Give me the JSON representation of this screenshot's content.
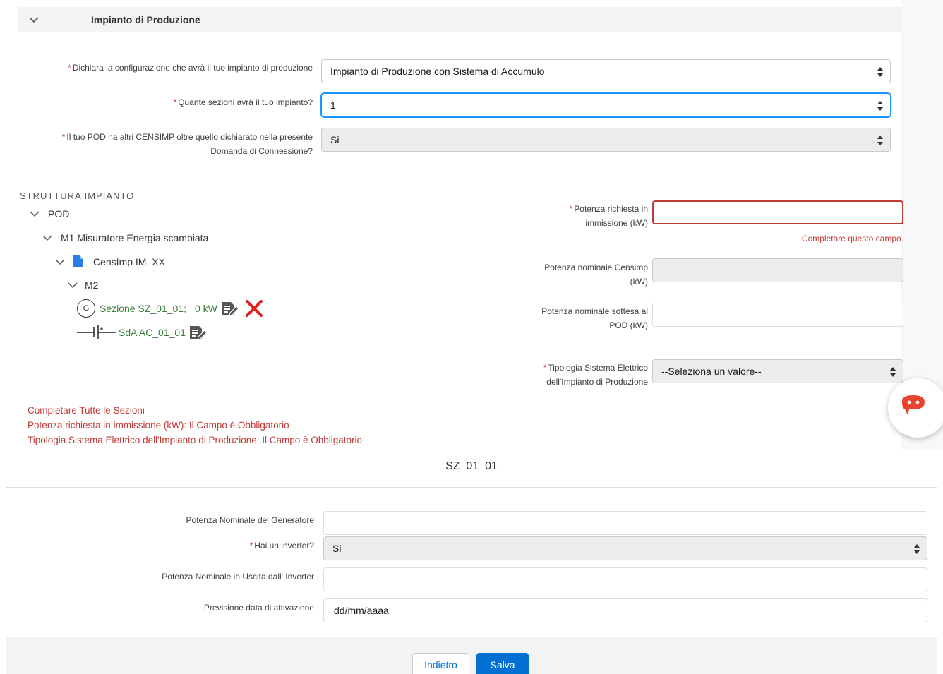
{
  "section": {
    "title": "Impianto di Produzione"
  },
  "form": {
    "config_label": "Dichiara la configurazione che avrà il tuo impianto di produzione",
    "config_value": "Impianto di Produzione con Sistema di Accumulo",
    "sections_label": "Quante sezioni avrà il tuo impianto?",
    "sections_value": "1",
    "pod_label_line1": "Il tuo POD ha altri CENSIMP oltre quello dichiarato nella presente",
    "pod_label_line2": "Domanda di Connessione?",
    "pod_value": "Si"
  },
  "tree": {
    "title": "STRUTTURA IMPIANTO",
    "pod": "POD",
    "meter": "M1 Misuratore Energia scambiata",
    "censimp": "CensImp IM_XX",
    "m2": "M2",
    "section_item": "Sezione SZ_01_01;",
    "section_power": "0 kW",
    "generator_symbol": "G",
    "storage_item": "SdA AC_01_01"
  },
  "right_form": {
    "potenza_richiesta_line1": "Potenza richiesta in",
    "potenza_richiesta_line2": "immissione (kW)",
    "error_text": "Completare questo campo.",
    "potenza_censimp_line1": "Potenza nominale Censimp",
    "potenza_censimp_line2": "(kW)",
    "potenza_pod_line1": "Potenza nominale sottesa al",
    "potenza_pod_line2": "POD (kW)",
    "tipologia_line1": "Tipologia Sistema Elettrico",
    "tipologia_line2": "dell'Impianto di Produzione",
    "tipologia_value": "--Seleziona un valore--"
  },
  "errors": [
    "Completare Tutte le Sezioni",
    "Potenza richiesta in immissione (kW): Il Campo è Obbligatorio",
    "Tipologia Sistema Elettrico dell'Impianto di Produzione: Il Campo è Obbligatorio"
  ],
  "section_detail": {
    "title": "SZ_01_01",
    "gen_power_label": "Potenza Nominale del Generatore",
    "inverter_label": "Hai un inverter?",
    "inverter_value": "Si",
    "inverter_power_label": "Potenza Nominale in Uscita dall' Inverter",
    "activation_label": "Previsione data di attivazione",
    "activation_placeholder": "dd/mm/aaaa"
  },
  "footer": {
    "back_label": "Indietro",
    "save_label": "Salva"
  },
  "colors": {
    "error": "#c23934",
    "brand": "#0070d2",
    "tree_green": "#3a7d3a"
  }
}
